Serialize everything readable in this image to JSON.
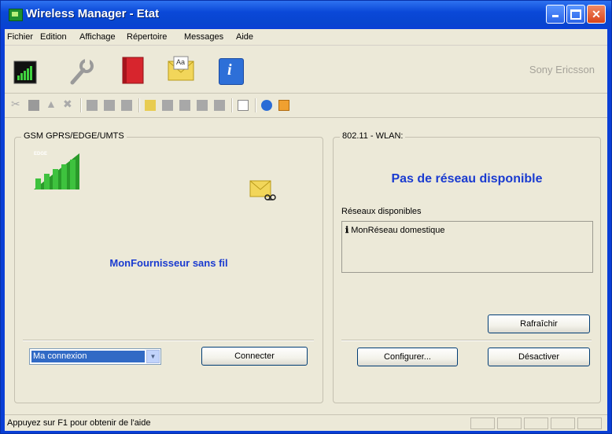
{
  "window": {
    "title": "Wireless Manager - Etat"
  },
  "menu": [
    "Fichier",
    "Edition",
    "Affichage",
    "Répertoire",
    "Messages",
    "Aide"
  ],
  "toolbar": {
    "brand": "Sony Ericsson",
    "big_icons": [
      "signal-icon",
      "wrench-icon",
      "address-book-icon",
      "message-icon",
      "info-icon"
    ],
    "info_glyph": "i",
    "message_glyph": "Aa"
  },
  "gsm": {
    "label": "GSM GPRS/EDGE/UMTS",
    "edge_badge": "EDGE",
    "provider": "MonFournisseur sans fil",
    "connection_value": "Ma connexion",
    "connect_button": "Connecter",
    "signal_bars": 5
  },
  "wlan": {
    "label": "802.11 - WLAN:",
    "status": "Pas de réseau disponible",
    "networks_label": "Réseaux disponibles",
    "networks": [
      "MonRéseau domestique"
    ],
    "refresh_button": "Rafraîchir",
    "configure_button": "Configurer...",
    "disable_button": "Désactiver"
  },
  "status": {
    "text": "Appuyez sur F1 pour obtenir de l'aide"
  },
  "colors": {
    "title_blue": "#0a48d8",
    "accent_text": "#1a3bd0",
    "signal_green": "#2a9a2a"
  }
}
